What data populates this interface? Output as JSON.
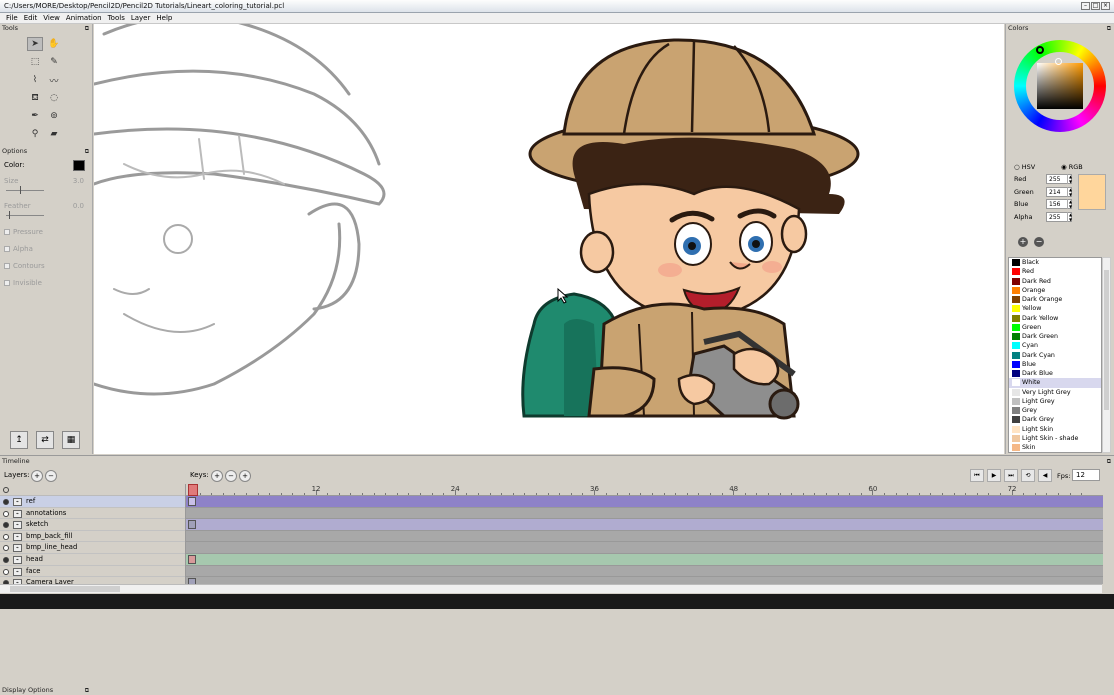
{
  "window": {
    "title": "C:/Users/MORE/Desktop/Pencil2D/Pencil2D Tutorials/Lineart_coloring_tutorial.pcl"
  },
  "menu": [
    "File",
    "Edit",
    "View",
    "Animation",
    "Tools",
    "Layer",
    "Help"
  ],
  "tools_panel": {
    "title": "Tools"
  },
  "options": {
    "title": "Options",
    "color_label": "Color:",
    "color_value": "#000000",
    "size_label": "Size",
    "size_value": "3.0",
    "feather_label": "Feather",
    "feather_value": "0.0",
    "checks": [
      "Pressure",
      "Alpha",
      "Contours",
      "Invisible"
    ]
  },
  "display_options": {
    "title": "Display Options"
  },
  "colors_panel": {
    "title": "Colors",
    "mode_hsv": "HSV",
    "mode_rgb": "RGB",
    "rows": [
      {
        "label": "Red",
        "value": "255"
      },
      {
        "label": "Green",
        "value": "214"
      },
      {
        "label": "Blue",
        "value": "156"
      },
      {
        "label": "Alpha",
        "value": "255"
      }
    ],
    "swatch": "#ffd69c"
  },
  "palette": [
    {
      "name": "Black",
      "color": "#000000"
    },
    {
      "name": "Red",
      "color": "#ff0000"
    },
    {
      "name": "Dark Red",
      "color": "#800000"
    },
    {
      "name": "Orange",
      "color": "#ff8000"
    },
    {
      "name": "Dark Orange",
      "color": "#804000"
    },
    {
      "name": "Yellow",
      "color": "#ffff00"
    },
    {
      "name": "Dark Yellow",
      "color": "#808000"
    },
    {
      "name": "Green",
      "color": "#00ff00"
    },
    {
      "name": "Dark Green",
      "color": "#008000"
    },
    {
      "name": "Cyan",
      "color": "#00ffff"
    },
    {
      "name": "Dark Cyan",
      "color": "#008080"
    },
    {
      "name": "Blue",
      "color": "#0000ff"
    },
    {
      "name": "Dark Blue",
      "color": "#000080"
    },
    {
      "name": "White",
      "color": "#ffffff"
    },
    {
      "name": "Very Light Grey",
      "color": "#e6e6e6"
    },
    {
      "name": "Light Grey",
      "color": "#c0c0c0"
    },
    {
      "name": "Grey",
      "color": "#808080"
    },
    {
      "name": "Dark Grey",
      "color": "#404040"
    },
    {
      "name": "Light Skin",
      "color": "#ffe4c4"
    },
    {
      "name": "Light Skin - shade",
      "color": "#f0c8a0"
    },
    {
      "name": "Skin",
      "color": "#f5b887"
    }
  ],
  "timeline": {
    "title": "Timeline",
    "layers_label": "Layers:",
    "keys_label": "Keys:",
    "fps_label": "Fps:",
    "fps_value": "12",
    "ruler": [
      "12",
      "24",
      "36",
      "48",
      "60",
      "72"
    ],
    "layers": [
      {
        "name": "ref",
        "visible": true,
        "color": "#8e82c8"
      },
      {
        "name": "annotations",
        "visible": false,
        "color": "#a8a8a8"
      },
      {
        "name": "sketch",
        "visible": true,
        "color": "#b0acd0"
      },
      {
        "name": "bmp_back_fill",
        "visible": false,
        "color": "#a8a8a8"
      },
      {
        "name": "bmp_line_head",
        "visible": false,
        "color": "#a8a8a8"
      },
      {
        "name": "head",
        "visible": true,
        "color": "#a6c8ae"
      },
      {
        "name": "face",
        "visible": false,
        "color": "#a8a8a8"
      },
      {
        "name": "Camera Layer",
        "visible": true,
        "color": "#a8a8a8"
      }
    ]
  }
}
